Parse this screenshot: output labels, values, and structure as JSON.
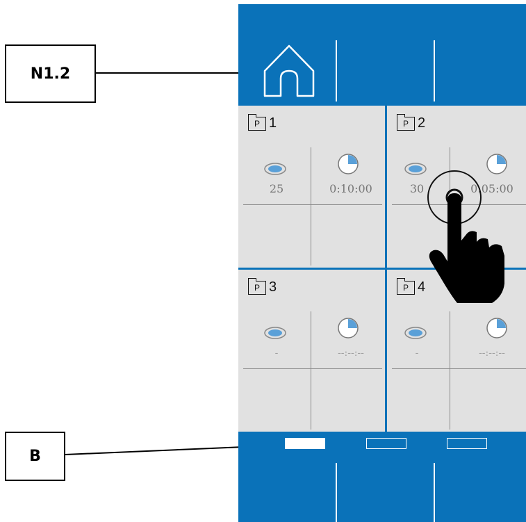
{
  "callouts": {
    "n12": "N1.2",
    "b": "B"
  },
  "device": {
    "accent_color": "#0a72b9",
    "home_icon": "home-icon",
    "panels": [
      {
        "number": "1",
        "badge": "P",
        "count": "25",
        "time": "0:10:00"
      },
      {
        "number": "2",
        "badge": "P",
        "count": "30",
        "time": "0:05:00"
      },
      {
        "number": "3",
        "badge": "P",
        "count": "-",
        "time": "--:--:--"
      },
      {
        "number": "4",
        "badge": "P",
        "count": "-",
        "time": "--:--:--"
      }
    ],
    "pager": {
      "pages": 3,
      "active_page": 1
    },
    "overlay_icon": "tap-hand-icon"
  }
}
